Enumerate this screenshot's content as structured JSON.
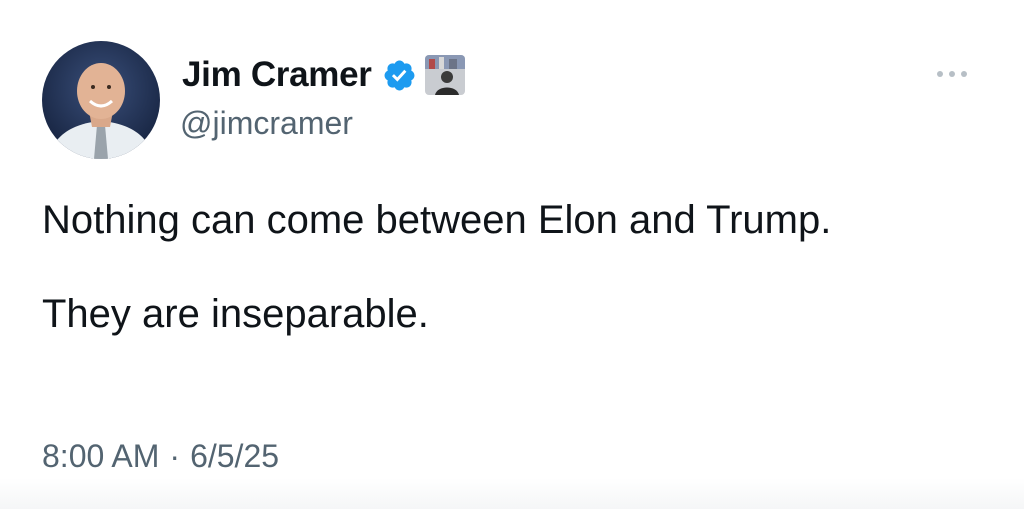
{
  "author": {
    "display_name": "Jim Cramer",
    "handle": "@jimcramer",
    "verified_icon": "verified-badge-icon",
    "affiliation_icon": "affiliate-badge-icon"
  },
  "menu": {
    "icon": "more-horizontal-icon"
  },
  "tweet": {
    "lines": [
      "Nothing can come between Elon and Trump.",
      "They are inseparable."
    ],
    "time": "8:00 AM",
    "separator": "·",
    "date": "6/5/25"
  },
  "colors": {
    "text": "#0f1419",
    "secondary": "#536471",
    "verified_blue": "#1d9bf0",
    "avatar_background": "#1b2a4a"
  }
}
